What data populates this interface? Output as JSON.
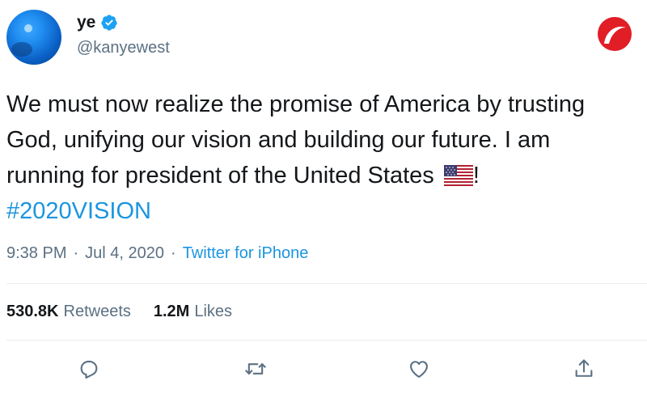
{
  "author": {
    "display_name": "ye",
    "handle": "@kanyewest",
    "verified_icon": "verified-badge-icon",
    "avatar_icon": "avatar-globe-icon"
  },
  "brand_logo_icon": "brand-logo-icon",
  "tweet": {
    "lines": [
      "We must now realize the promise of America by trusting",
      "God, unifying our vision and building our future. I am",
      "running for president of the United States"
    ],
    "line3_suffix": "!",
    "flag_icon": "us-flag-icon",
    "hashtag": "#2020VISION"
  },
  "meta": {
    "time": "9:38 PM",
    "separator": "·",
    "date": "Jul 4, 2020",
    "source": "Twitter for iPhone"
  },
  "stats": {
    "retweets_count": "530.8K",
    "retweets_label": "Retweets",
    "likes_count": "1.2M",
    "likes_label": "Likes"
  },
  "actions": [
    "reply-icon",
    "retweet-icon",
    "like-icon",
    "share-icon"
  ],
  "colors": {
    "link": "#1b95e0",
    "muted": "#5b7083",
    "text": "#14171a",
    "divider": "#e6ecf0",
    "brand": "#e11d26"
  }
}
